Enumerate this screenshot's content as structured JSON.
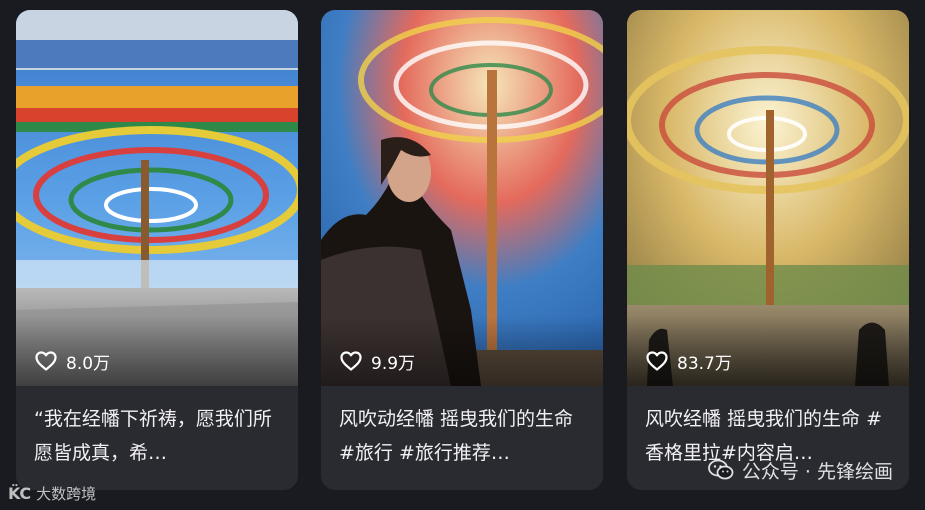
{
  "cards": [
    {
      "likes": "8.0万",
      "caption": "“我在经幡下祈祷，愿我们所愿皆成真，希…"
    },
    {
      "likes": "9.9万",
      "caption": "风吹动经幡 摇曳我们的生命 #旅行 #旅行推荐…"
    },
    {
      "likes": "83.7万",
      "caption": "风吹经幡 摇曳我们的生命 #香格里拉#内容启…"
    }
  ],
  "watermark": {
    "left_logo": "K̈C",
    "left_text": "大数跨境",
    "right_text": "公众号 · 先锋绘画"
  },
  "colors": {
    "background": "#1a1b20",
    "card": "#2a2b31"
  }
}
